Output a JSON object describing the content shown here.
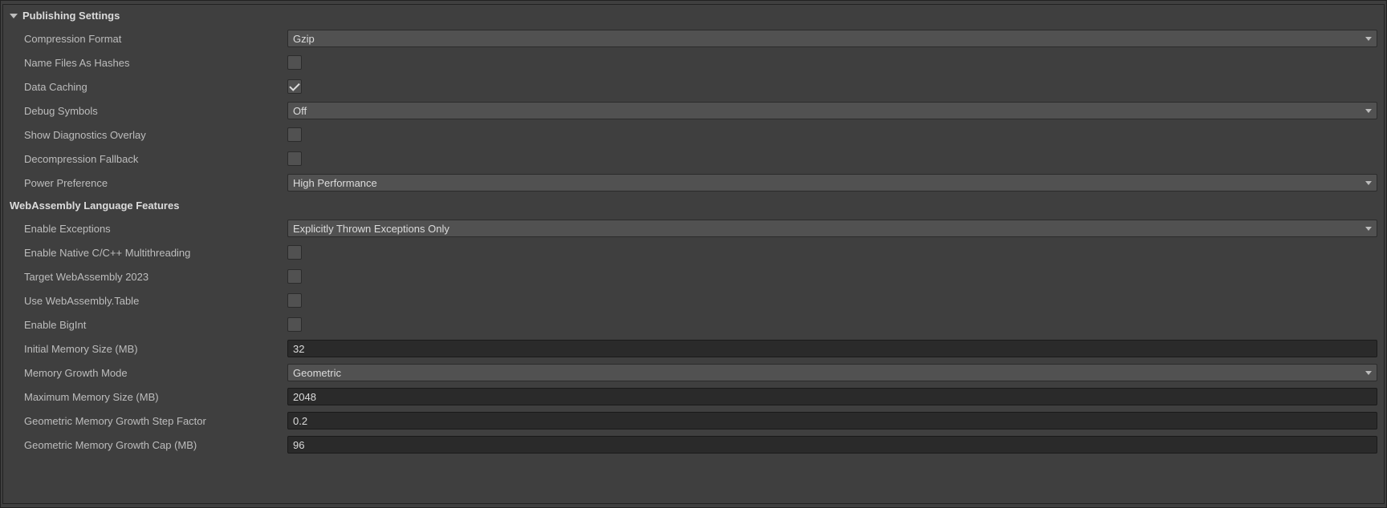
{
  "publishing": {
    "title": "Publishing Settings",
    "fields": {
      "compression_format": {
        "label": "Compression Format",
        "value": "Gzip"
      },
      "name_files_as_hashes": {
        "label": "Name Files As Hashes",
        "checked": false
      },
      "data_caching": {
        "label": "Data Caching",
        "checked": true
      },
      "debug_symbols": {
        "label": "Debug Symbols",
        "value": "Off"
      },
      "show_diagnostics_overlay": {
        "label": "Show Diagnostics Overlay",
        "checked": false
      },
      "decompression_fallback": {
        "label": "Decompression Fallback",
        "checked": false
      },
      "power_preference": {
        "label": "Power Preference",
        "value": "High Performance"
      }
    }
  },
  "wasm": {
    "title": "WebAssembly Language Features",
    "fields": {
      "enable_exceptions": {
        "label": "Enable Exceptions",
        "value": "Explicitly Thrown Exceptions Only"
      },
      "enable_native_multithreading": {
        "label": "Enable Native C/C++ Multithreading",
        "checked": false
      },
      "target_wasm_2023": {
        "label": "Target WebAssembly 2023",
        "checked": false
      },
      "use_wasm_table": {
        "label": "Use WebAssembly.Table",
        "checked": false
      },
      "enable_bigint": {
        "label": "Enable BigInt",
        "checked": false
      },
      "initial_memory_size": {
        "label": "Initial Memory Size (MB)",
        "value": "32"
      },
      "memory_growth_mode": {
        "label": "Memory Growth Mode",
        "value": "Geometric"
      },
      "maximum_memory_size": {
        "label": "Maximum Memory Size (MB)",
        "value": "2048"
      },
      "geometric_growth_step_factor": {
        "label": "Geometric Memory Growth Step Factor",
        "value": "0.2"
      },
      "geometric_growth_cap": {
        "label": "Geometric Memory Growth Cap (MB)",
        "value": "96"
      }
    }
  }
}
